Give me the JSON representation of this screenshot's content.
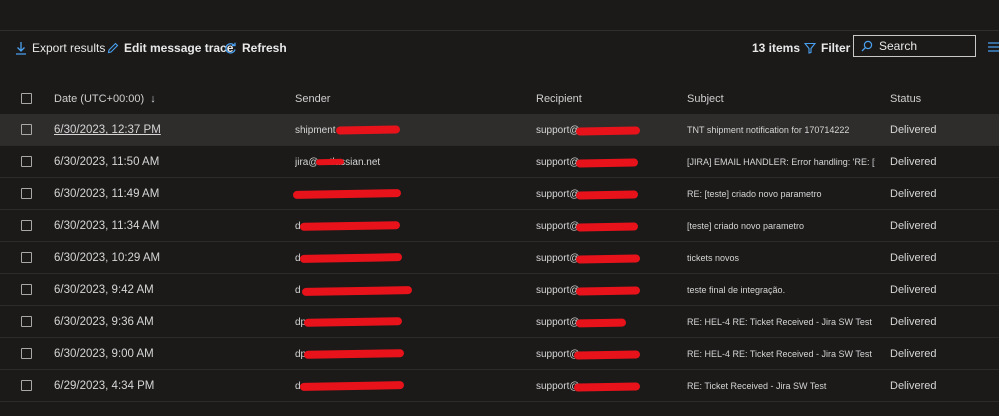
{
  "toolbar": {
    "export_label": "Export results",
    "edit_label": "Edit message trace",
    "refresh_label": "Refresh",
    "items_count": "13 items",
    "filter_label": "Filter",
    "search_placeholder": "Search"
  },
  "icons": {
    "export": "download-arrow-icon",
    "edit": "pencil-icon",
    "refresh": "refresh-icon",
    "filter": "funnel-icon",
    "search": "search-icon",
    "menu": "list-icon"
  },
  "colors": {
    "accent": "#4aa0f0",
    "background": "#1b1a19",
    "selected_row": "#2e2d2c",
    "redaction": "#e8121b"
  },
  "table": {
    "headers": {
      "date": "Date (UTC+00:00)",
      "sort_indicator": "↓",
      "sender": "Sender",
      "recipient": "Recipient",
      "subject": "Subject",
      "status": "Status"
    },
    "rows": [
      {
        "date": "6/30/2023, 12:37 PM",
        "sender": "shipment",
        "recipient": "support@",
        "subject": "TNT shipment notification for 170714222",
        "status": "Delivered"
      },
      {
        "date": "6/30/2023, 11:50 AM",
        "sender": "jira@                .atlassian.net",
        "recipient": "support@",
        "subject": "[JIRA] EMAIL HANDLER: Error handling: 'RE: [t...",
        "status": "Delivered"
      },
      {
        "date": "6/30/2023, 11:49 AM",
        "sender": "",
        "recipient": "support@",
        "subject": "RE: [teste] criado novo parametro",
        "status": "Delivered"
      },
      {
        "date": "6/30/2023, 11:34 AM",
        "sender": "d",
        "recipient": "support@",
        "subject": "[teste] criado novo parametro",
        "status": "Delivered"
      },
      {
        "date": "6/30/2023, 10:29 AM",
        "sender": "d",
        "recipient": "support@",
        "subject": "tickets novos",
        "status": "Delivered"
      },
      {
        "date": "6/30/2023, 9:42 AM",
        "sender": "d",
        "recipient": "support@",
        "subject": "teste final de integração.",
        "status": "Delivered"
      },
      {
        "date": "6/30/2023, 9:36 AM",
        "sender": "dp",
        "recipient": "support@",
        "subject": "RE: HEL-4 RE: Ticket Received - Jira SW Test",
        "status": "Delivered"
      },
      {
        "date": "6/30/2023, 9:00 AM",
        "sender": "dp",
        "recipient": "support@",
        "subject": "RE: HEL-4 RE: Ticket Received - Jira SW Test",
        "status": "Delivered"
      },
      {
        "date": "6/29/2023, 4:34 PM",
        "sender": "d",
        "recipient": "support@",
        "subject": "RE: Ticket Received - Jira SW Test",
        "status": "Delivered"
      }
    ]
  }
}
